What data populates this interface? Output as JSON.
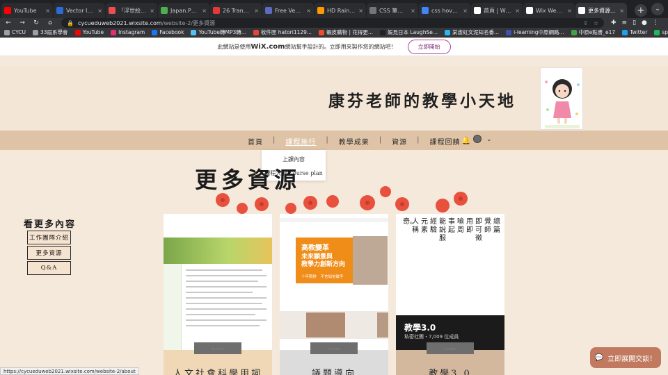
{
  "browser": {
    "tabs": [
      {
        "title": "YouTube",
        "color": "#ff0000"
      },
      {
        "title": "Vector Icons a",
        "color": "#2b6bd6"
      },
      {
        "title": "「浮世絵」◎ C",
        "color": "#e94f4f"
      },
      {
        "title": "Japan.PNG - ",
        "color": "#4caf50"
      },
      {
        "title": "26 Transparen",
        "color": "#e53935"
      },
      {
        "title": "Free Vectors,",
        "color": "#5c6bc0"
      },
      {
        "title": "HD Rainbow ",
        "color": "#ff9800"
      },
      {
        "title": "CSS 筆記 - 去",
        "color": "#757575"
      },
      {
        "title": "css hover 圖片",
        "color": "#4285f4"
      },
      {
        "title": "首頁 | Wix.com",
        "color": "#ffffff"
      },
      {
        "title": "Wix Website E",
        "color": "#ffffff"
      },
      {
        "title": "更多資源 | 康芬",
        "color": "#ffffff"
      }
    ],
    "active_tab_index": 11,
    "new_tab_label": "+",
    "menu_label": "⌄",
    "url_host": "cycueduweb2021.wixsite.com",
    "url_path": "/website-2/更多資源",
    "bookmarks": [
      {
        "label": "CYCU",
        "color": "#9aa0a6"
      },
      {
        "label": "33屆系學會",
        "color": "#9aa0a6"
      },
      {
        "label": "YouTube",
        "color": "#ff0000"
      },
      {
        "label": "Instagram",
        "color": "#e1306c"
      },
      {
        "label": "Facebook",
        "color": "#1877f2"
      },
      {
        "label": "YouTube轉MP3轉...",
        "color": "#4fc3f7"
      },
      {
        "label": "收件匣 hatori1129...",
        "color": "#ea4335"
      },
      {
        "label": "蝦皮購物 | 花得更...",
        "color": "#ee4d2d"
      },
      {
        "label": "娛見日本 LaughSe...",
        "color": "#222222"
      },
      {
        "label": "某虛虹文泥知名番...",
        "color": "#29b6f6"
      },
      {
        "label": "i-learning中原網路...",
        "color": "#3f51b5"
      },
      {
        "label": "中原e點書_e17",
        "color": "#43a047"
      },
      {
        "label": "Twitter",
        "color": "#1da1f2"
      },
      {
        "label": "spotify",
        "color": "#1db954"
      },
      {
        "label": "Gimy劇迷",
        "color": "#9aa0a6"
      },
      {
        "label": "警告|麵對你了| NTV",
        "color": "#9aa0a6"
      }
    ]
  },
  "wix_banner": {
    "prefix": "此網站是使用",
    "brand": "WiX.com",
    "suffix": "網站幫手設計的。立即用來製作您的網站吧！",
    "button": "立即開始"
  },
  "site": {
    "title": "康芬老師的教學小天地",
    "nav": [
      {
        "label": "首頁",
        "active": false
      },
      {
        "label": "課程施行",
        "active": true
      },
      {
        "label": "教學成果",
        "active": false
      },
      {
        "label": "資源",
        "active": false
      },
      {
        "label": "課程回饋",
        "active": false
      }
    ],
    "dropdown": [
      "上課內容",
      "課程大綱/Course plan"
    ],
    "page_heading": "更多資源",
    "sidebar_title": "看更多內容",
    "sidebar_buttons": [
      "工作團隊介紹",
      "更多資源",
      "Q&A"
    ],
    "cards": [
      {
        "caption": "人文社會科學用詞",
        "more": "......"
      },
      {
        "caption": "議題導向",
        "more": "......",
        "poster_line1": "高教變革",
        "poster_line2": "未來願景與",
        "poster_line3": "教學力創新方向",
        "poster_note": "十年限拚　不言如信破手"
      },
      {
        "caption": "教學3.0",
        "more": "......",
        "group_name": "教學3.0",
        "group_meta": "私密社團・7,009 位成員"
      }
    ],
    "poem_columns": [
      "總篇",
      "覺師",
      "即可徵",
      "用即",
      "喻周",
      "事起",
      "能說服",
      "經驗",
      "元素",
      "人稱",
      "奇。"
    ],
    "chat_button": "立即展開交談！",
    "status_url": "https://cycueduweb2021.wixsite.com/website-2/about"
  }
}
